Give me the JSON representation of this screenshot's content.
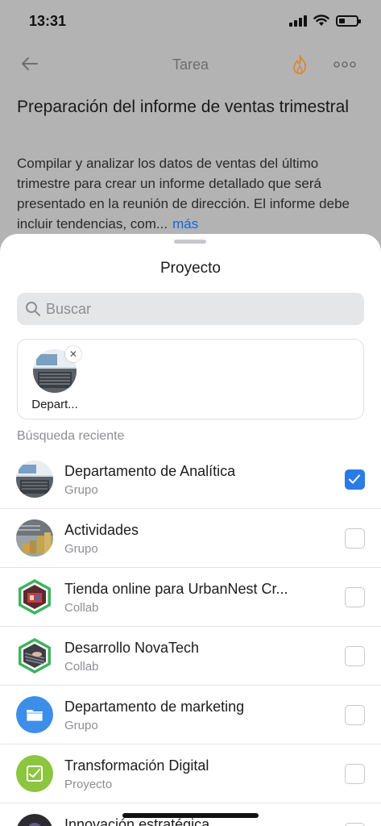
{
  "status_bar": {
    "time": "13:31"
  },
  "nav": {
    "title": "Tarea"
  },
  "task": {
    "title": "Preparación del informe de ventas trimestral",
    "description": "Compilar y analizar los datos de ventas del último trimestre para crear un informe detallado que será presentado en la reunión de dirección. El informe debe incluir tendencias, com...",
    "more_label": "más"
  },
  "sheet": {
    "title": "Proyecto",
    "search_placeholder": "Buscar",
    "selected": [
      {
        "label": "Depart..."
      }
    ],
    "recent_label": "Búsqueda reciente",
    "items": [
      {
        "name": "Departamento de Analítica",
        "type": "Grupo",
        "checked": true,
        "icon": "laptop-photo"
      },
      {
        "name": "Actividades",
        "type": "Grupo",
        "checked": false,
        "icon": "coins-photo"
      },
      {
        "name": "Tienda online para UrbanNest Cr...",
        "type": "Collab",
        "checked": false,
        "icon": "shop-photo-hexagon"
      },
      {
        "name": "Desarrollo NovaTech",
        "type": "Collab",
        "checked": false,
        "icon": "keyboard-photo-hexagon"
      },
      {
        "name": "Departamento de marketing",
        "type": "Grupo",
        "checked": false,
        "icon": "folder-icon"
      },
      {
        "name": "Transformación Digital",
        "type": "Proyecto",
        "checked": false,
        "icon": "project-icon"
      },
      {
        "name": "Innovación estratégica",
        "type": "",
        "checked": false,
        "icon": "photo"
      }
    ]
  },
  "colors": {
    "accent": "#2a7be4",
    "link": "#1a66c8",
    "fire": "#d9892b",
    "folder_bg": "#3d8ee8",
    "project_bg": "#8cc63e"
  }
}
